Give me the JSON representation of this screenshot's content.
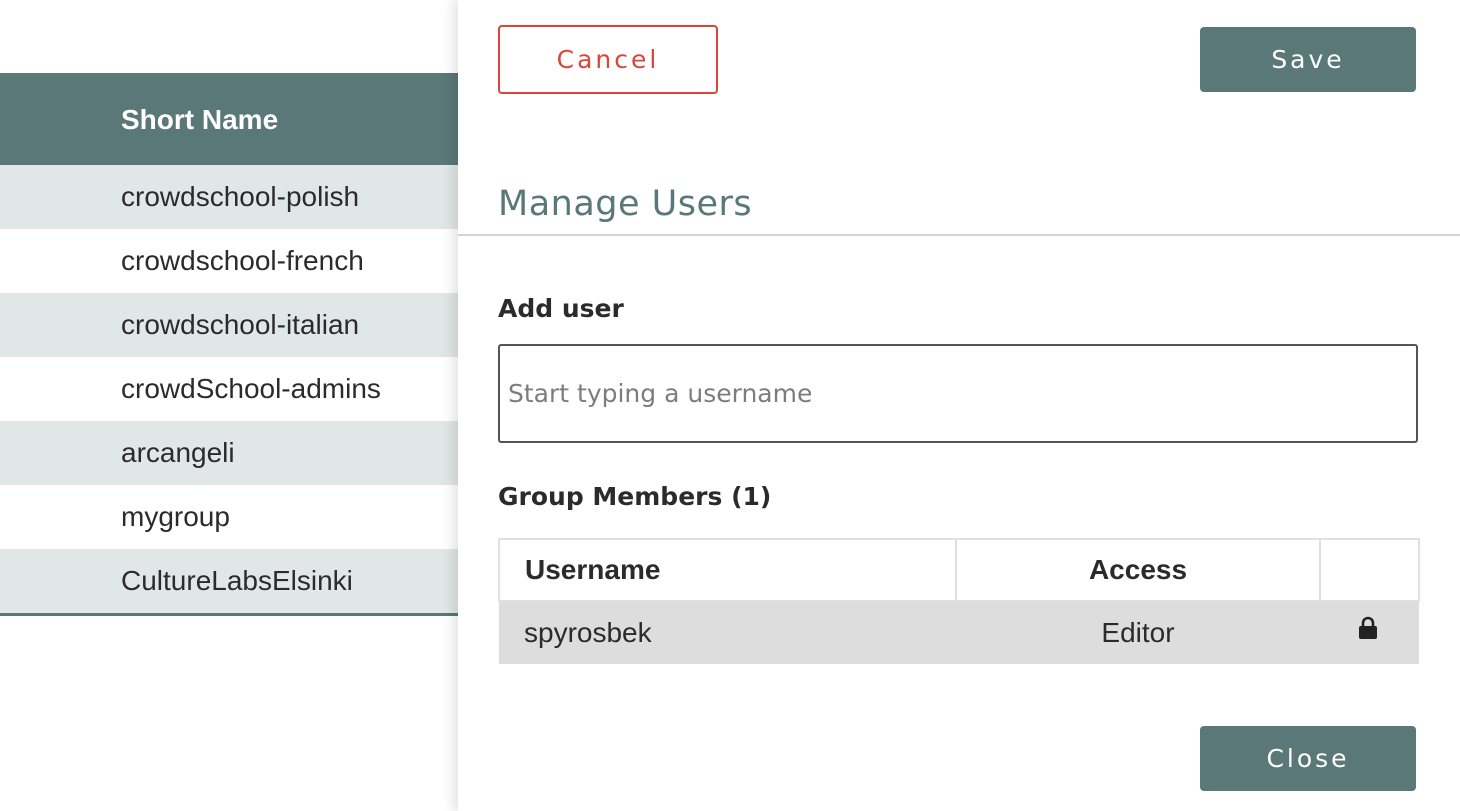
{
  "background_table": {
    "header": "Short Name",
    "rows": [
      "crowdschool-polish",
      "crowdschool-french",
      "crowdschool-italian",
      "crowdSchool-admins",
      "arcangeli",
      "mygroup",
      "CultureLabsElsinki"
    ]
  },
  "panel": {
    "cancel_label": "Cancel",
    "save_label": "Save",
    "close_label": "Close",
    "section_title": "Manage Users",
    "add_user": {
      "label": "Add user",
      "placeholder": "Start typing a username",
      "value": ""
    },
    "members": {
      "title": "Group Members (1)",
      "columns": {
        "username": "Username",
        "access": "Access",
        "actions": ""
      },
      "rows": [
        {
          "username": "spyrosbek",
          "access": "Editor",
          "icon": "lock-icon"
        }
      ]
    }
  },
  "colors": {
    "accent": "#5a7877",
    "cancel": "#d9473b",
    "row_stripe": "#e1e7e7",
    "member_row": "#dddddd"
  }
}
